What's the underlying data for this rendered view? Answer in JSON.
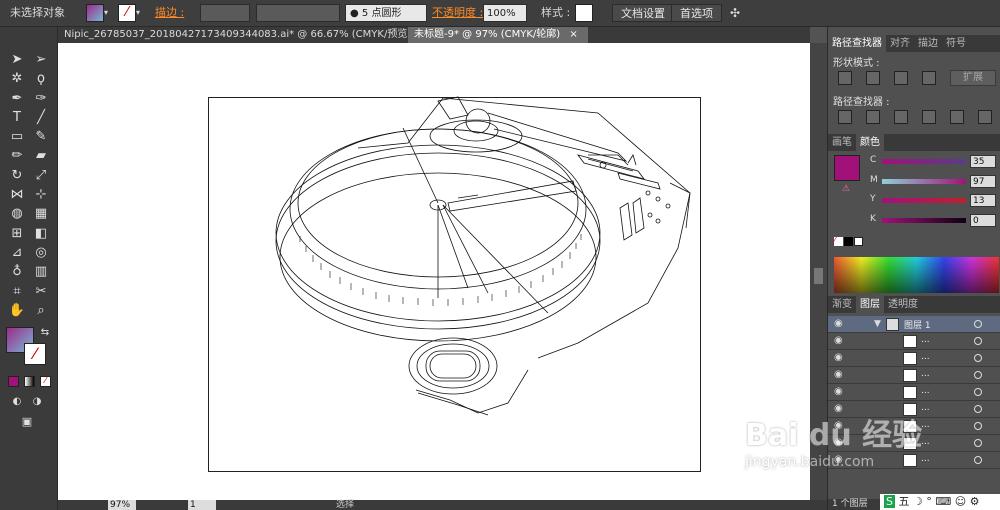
{
  "control_bar": {
    "selection_status": "未选择对象",
    "stroke_label": "描边 :",
    "brush": "5 点圆形",
    "opacity_label": "不透明度 :",
    "opacity_value": "100%",
    "style_label": "样式 :",
    "doc_settings_button": "文档设置",
    "prefs_button": "首选项"
  },
  "document_tabs": [
    {
      "label": "Nipic_26785037_20180427173409344083.ai* @ 66.67% (CMYK/预览)",
      "close": "×"
    },
    {
      "label": "未标题-9* @ 97% (CMYK/轮廓)",
      "close": "×"
    }
  ],
  "status_bar": {
    "zoom": "97%",
    "page": "1",
    "tool": "选择"
  },
  "pathfinder": {
    "tabs": [
      "路径查找器",
      "对齐",
      "描边",
      "符号"
    ],
    "shape_modes_label": "形状模式 :",
    "expand_button": "扩展",
    "pathfinders_label": "路径查找器 :"
  },
  "color_panel": {
    "tabs": [
      "画笔",
      "颜色"
    ],
    "fill_color": "#a0127a",
    "channels": [
      {
        "name": "C",
        "value": "35"
      },
      {
        "name": "M",
        "value": "97"
      },
      {
        "name": "Y",
        "value": "13"
      },
      {
        "name": "K",
        "value": "0"
      }
    ]
  },
  "layers_panel": {
    "tabs": [
      "渐变",
      "图层",
      "透明度"
    ],
    "top_layer": "图层 1",
    "sublayer_label": "...",
    "sublayer_count": 8,
    "footer": "1 个图层"
  },
  "watermark": {
    "line1": "Bai du 经验",
    "line2": "jingyan.baidu.com"
  }
}
